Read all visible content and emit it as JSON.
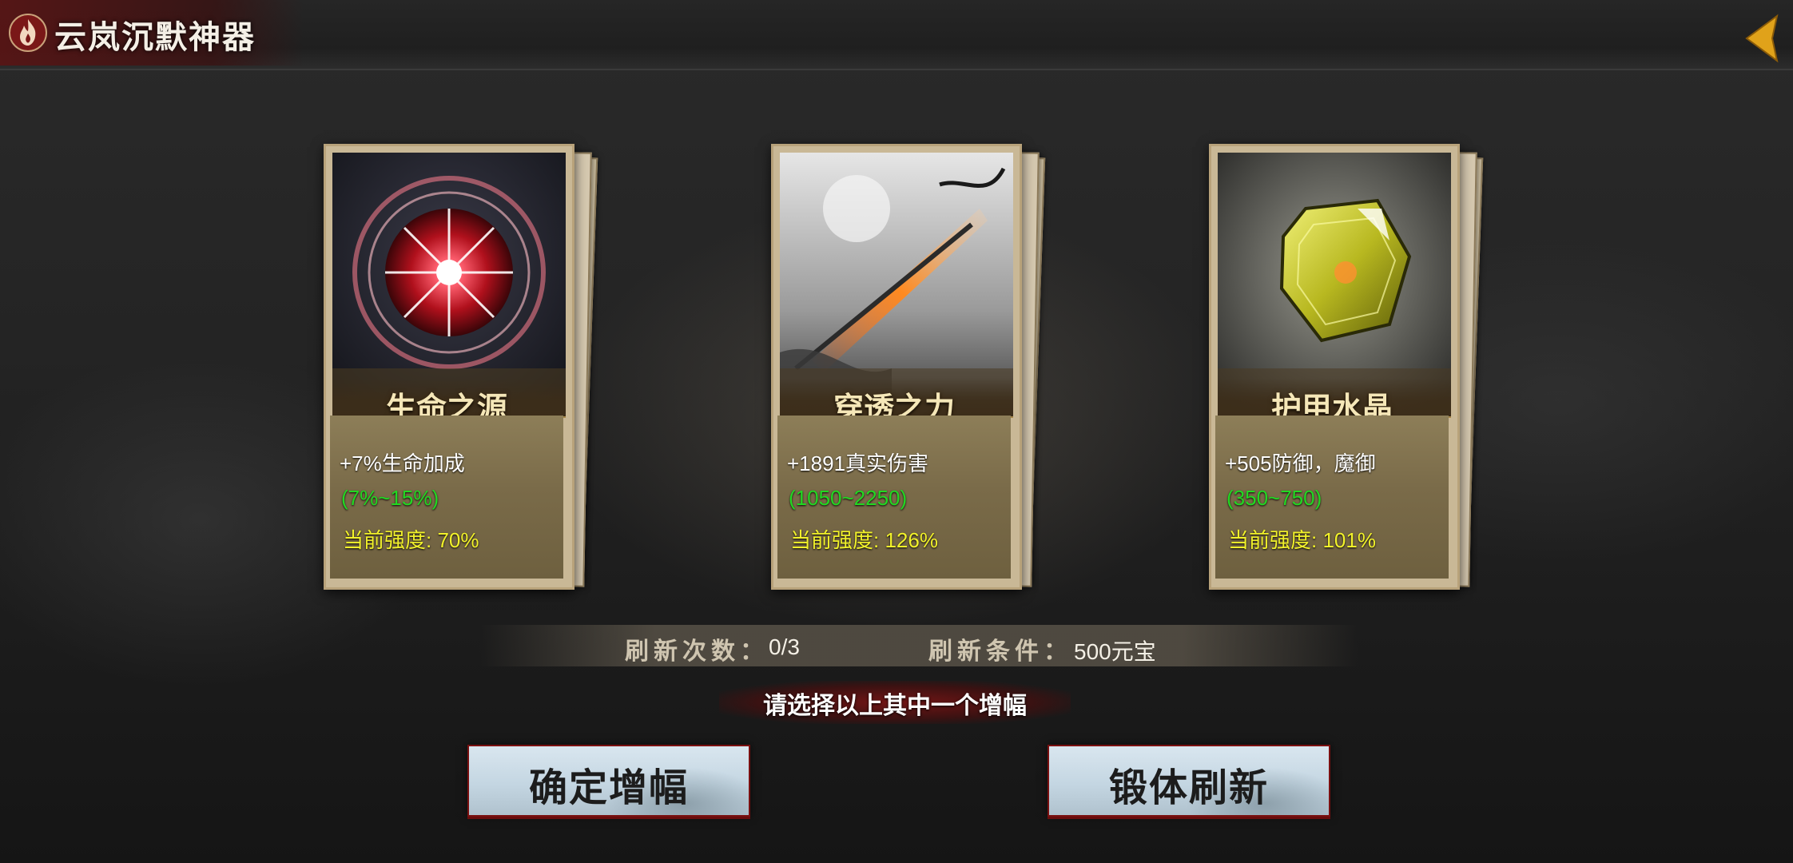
{
  "header": {
    "title": "云岚沉默神器",
    "title_icon": "flame-icon",
    "back_icon": "back-arrow-icon"
  },
  "cards": [
    {
      "name": "生命之源",
      "icon": "life-orb-icon",
      "stat": "+7%生命加成",
      "range": "(7%~15%)",
      "strength": "当前强度: 70%"
    },
    {
      "name": "穿透之力",
      "icon": "piercing-spear-icon",
      "stat": "+1891真实伤害",
      "range": "(1050~2250)",
      "strength": "当前强度: 126%"
    },
    {
      "name": "护甲水晶",
      "icon": "armor-crystal-icon",
      "stat": "+505防御，魔御",
      "range": "(350~750)",
      "strength": "当前强度: 101%"
    }
  ],
  "refresh": {
    "count_label": "刷新次数：",
    "count_value": "0/3",
    "cost_label": "刷新条件：",
    "cost_value": "500元宝"
  },
  "prompt": "请选择以上其中一个增幅",
  "buttons": {
    "confirm": "确定增幅",
    "refresh": "锻体刷新"
  },
  "colors": {
    "stat": "#ffffff",
    "range": "#22d822",
    "strength": "#f2f22a",
    "accent": "#7a1010",
    "back_arrow": "#e0a21a"
  }
}
